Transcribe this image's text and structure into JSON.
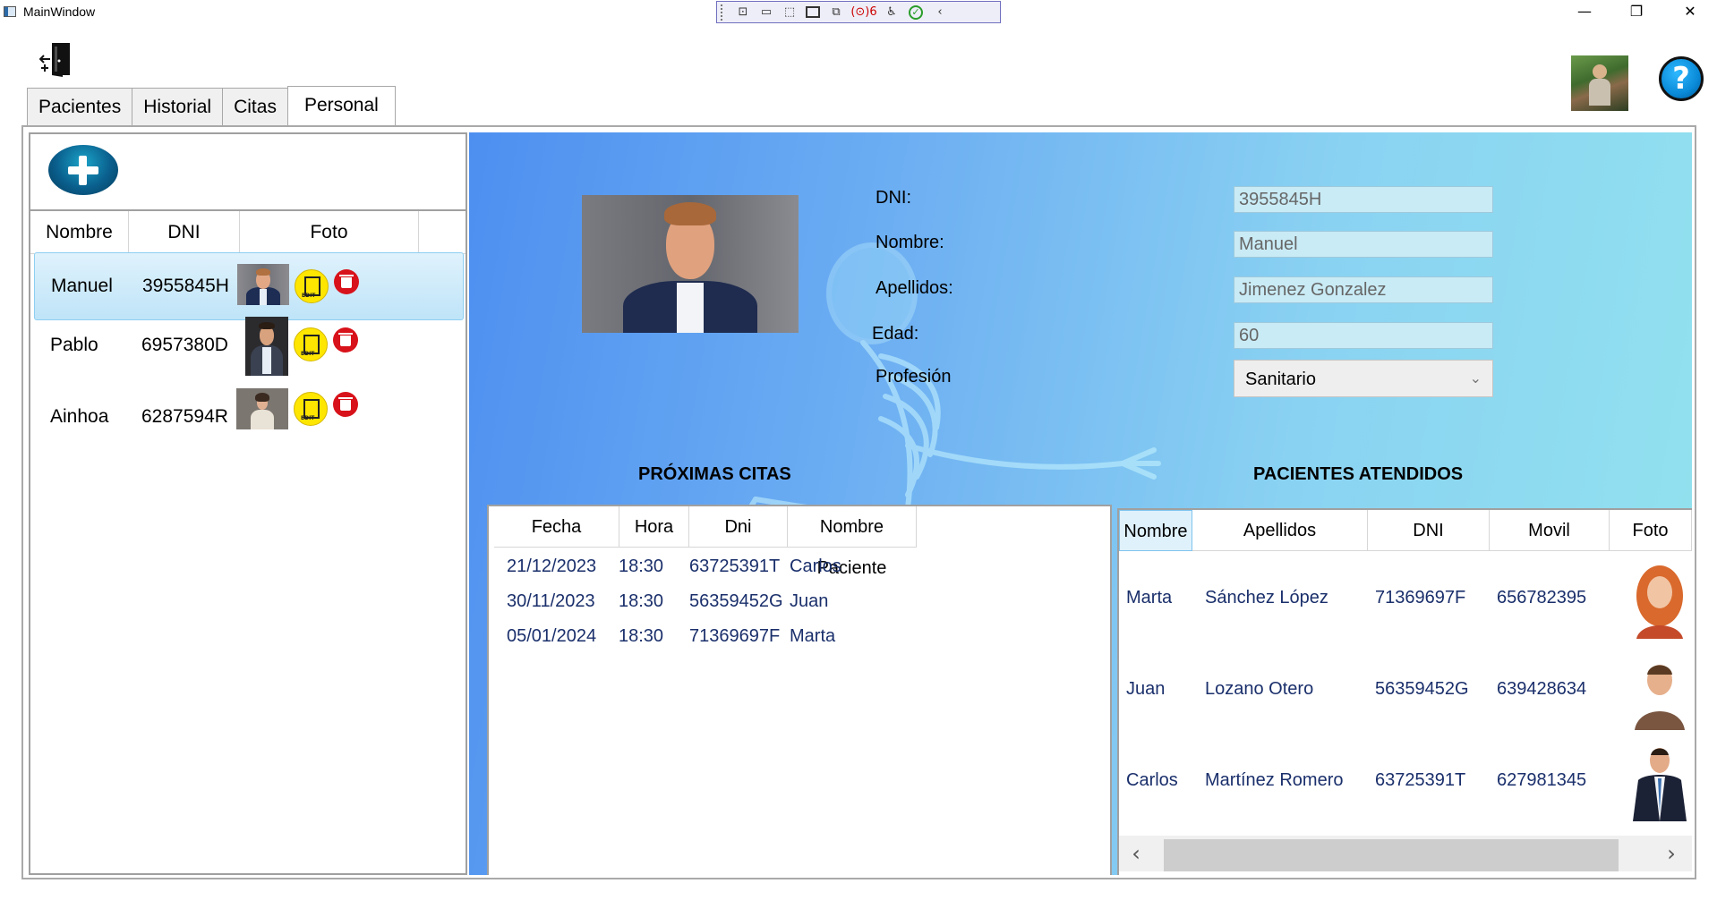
{
  "window": {
    "title": "MainWindow",
    "minimize": "—",
    "restore": "❐",
    "close": "✕"
  },
  "debug_toolbar": {
    "binding_errors": "(⊙)6"
  },
  "tabs": [
    {
      "label": "Pacientes"
    },
    {
      "label": "Historial"
    },
    {
      "label": "Citas"
    },
    {
      "label": "Personal",
      "active": true
    }
  ],
  "staff_list": {
    "columns": [
      "Nombre",
      "DNI",
      "Foto"
    ],
    "rows": [
      {
        "nombre": "Manuel",
        "dni": "3955845H",
        "selected": true
      },
      {
        "nombre": "Pablo",
        "dni": "6957380D"
      },
      {
        "nombre": "Ainhoa",
        "dni": "6287594R"
      }
    ]
  },
  "form": {
    "dni_label": "DNI:",
    "dni_value": "3955845H",
    "nombre_label": "Nombre:",
    "nombre_value": "Manuel",
    "apellidos_label": "Apellidos:",
    "apellidos_value": "Jimenez Gonzalez",
    "edad_label": "Edad:",
    "edad_value": "60",
    "profesion_label": "Profesión",
    "profesion_value": "Sanitario"
  },
  "proximas_citas": {
    "title": "PRÓXIMAS CITAS",
    "columns": [
      "Fecha",
      "Hora",
      "Dni",
      "Nombre Paciente"
    ],
    "rows": [
      {
        "fecha": "21/12/2023",
        "hora": "18:30",
        "dni": "63725391T",
        "nombre": "Carlos"
      },
      {
        "fecha": "30/11/2023",
        "hora": "18:30",
        "dni": "56359452G",
        "nombre": "Juan"
      },
      {
        "fecha": "05/01/2024",
        "hora": "18:30",
        "dni": "71369697F",
        "nombre": "Marta"
      }
    ]
  },
  "pacientes_atendidos": {
    "title": "PACIENTES ATENDIDOS",
    "columns": [
      "Nombre",
      "Apellidos",
      "DNI",
      "Movil",
      "Foto"
    ],
    "rows": [
      {
        "nombre": "Marta",
        "apellidos": "Sánchez López",
        "dni": "71369697F",
        "movil": "656782395"
      },
      {
        "nombre": "Juan",
        "apellidos": "Lozano Otero",
        "dni": "56359452G",
        "movil": "639428634"
      },
      {
        "nombre": "Carlos",
        "apellidos": "Martínez Romero",
        "dni": "63725391T",
        "movil": "627981345"
      }
    ]
  },
  "colors": {
    "panel_gradient_start": "#4d8ff0",
    "panel_gradient_end": "#92e3ee",
    "table_text": "#1a2f6b",
    "selection": "#bfe4f8",
    "input_bg": "#c9ebf5"
  }
}
